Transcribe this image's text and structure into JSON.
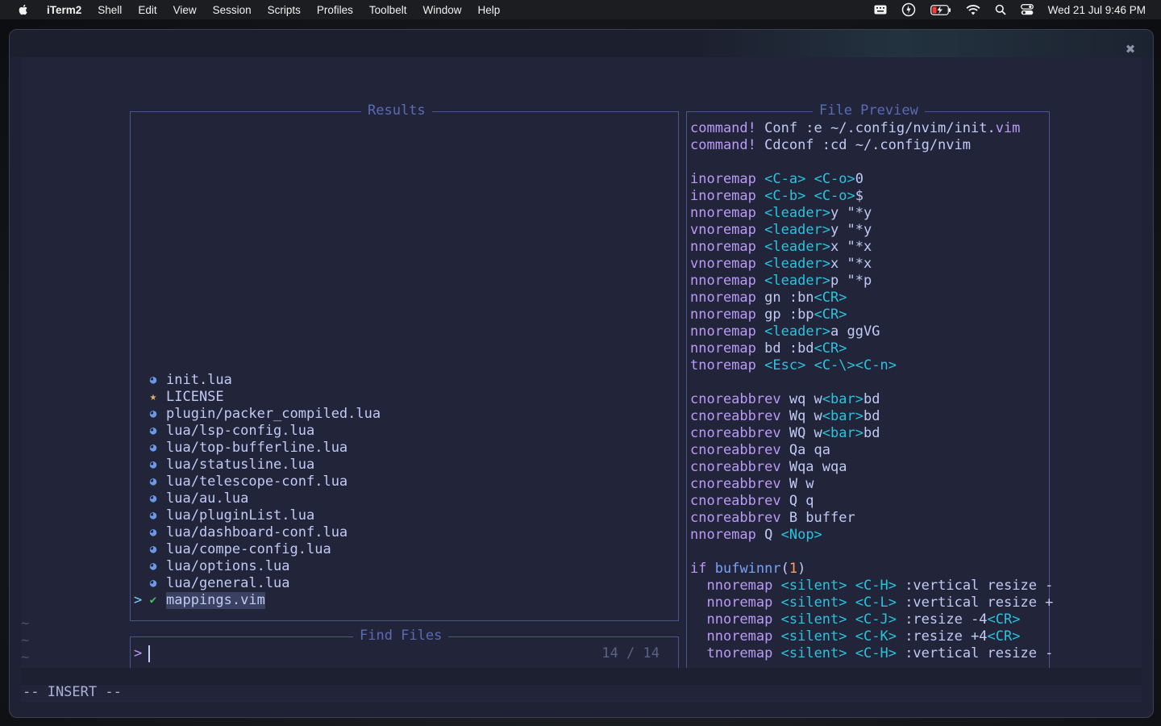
{
  "menubar": {
    "app_name": "iTerm2",
    "items": [
      "Shell",
      "Edit",
      "View",
      "Session",
      "Scripts",
      "Profiles",
      "Toolbelt",
      "Window",
      "Help"
    ],
    "clock": "Wed 21 Jul  9:46 PM",
    "status_icons": [
      "keyboard-icon",
      "vpn-icon",
      "battery-charging-icon",
      "wifi-icon",
      "spotlight-search-icon",
      "control-center-icon"
    ]
  },
  "telescope": {
    "results_title": "Results",
    "prompt_title": "Find Files",
    "preview_title": "File Preview",
    "prompt_symbol": ">",
    "selection_caret": ">",
    "counter": "14 / 14",
    "results": [
      {
        "name": "init.lua",
        "icon": "lua-icon"
      },
      {
        "name": "LICENSE",
        "icon": "license-icon"
      },
      {
        "name": "plugin/packer_compiled.lua",
        "icon": "lua-icon"
      },
      {
        "name": "lua/lsp-config.lua",
        "icon": "lua-icon"
      },
      {
        "name": "lua/top-bufferline.lua",
        "icon": "lua-icon"
      },
      {
        "name": "lua/statusline.lua",
        "icon": "lua-icon"
      },
      {
        "name": "lua/telescope-conf.lua",
        "icon": "lua-icon"
      },
      {
        "name": "lua/au.lua",
        "icon": "lua-icon"
      },
      {
        "name": "lua/pluginList.lua",
        "icon": "lua-icon"
      },
      {
        "name": "lua/dashboard-conf.lua",
        "icon": "lua-icon"
      },
      {
        "name": "lua/compe-config.lua",
        "icon": "lua-icon"
      },
      {
        "name": "lua/options.lua",
        "icon": "lua-icon"
      },
      {
        "name": "lua/general.lua",
        "icon": "lua-icon"
      },
      {
        "name": "mappings.vim",
        "icon": "vim-icon",
        "selected": true
      }
    ],
    "preview_lines": [
      [
        [
          "kw",
          "command!"
        ],
        [
          "tx",
          " Conf :e ~/.config/nvim/init."
        ],
        [
          "kw",
          "vim"
        ]
      ],
      [
        [
          "kw",
          "command!"
        ],
        [
          "tx",
          " Cdconf :cd ~/.config/nvim"
        ]
      ],
      [],
      [
        [
          "kw",
          "inoremap"
        ],
        [
          "tx",
          " "
        ],
        [
          "cy",
          "<C-a>"
        ],
        [
          "tx",
          " "
        ],
        [
          "cy",
          "<C-o>"
        ],
        [
          "tx",
          "0"
        ]
      ],
      [
        [
          "kw",
          "inoremap"
        ],
        [
          "tx",
          " "
        ],
        [
          "cy",
          "<C-b>"
        ],
        [
          "tx",
          " "
        ],
        [
          "cy",
          "<C-o>"
        ],
        [
          "tx",
          "$"
        ]
      ],
      [
        [
          "kw",
          "nnoremap"
        ],
        [
          "tx",
          " "
        ],
        [
          "cy",
          "<leader>"
        ],
        [
          "tx",
          "y \"*y"
        ]
      ],
      [
        [
          "kw",
          "vnoremap"
        ],
        [
          "tx",
          " "
        ],
        [
          "cy",
          "<leader>"
        ],
        [
          "tx",
          "y \"*y"
        ]
      ],
      [
        [
          "kw",
          "nnoremap"
        ],
        [
          "tx",
          " "
        ],
        [
          "cy",
          "<leader>"
        ],
        [
          "tx",
          "x \"*x"
        ]
      ],
      [
        [
          "kw",
          "vnoremap"
        ],
        [
          "tx",
          " "
        ],
        [
          "cy",
          "<leader>"
        ],
        [
          "tx",
          "x \"*x"
        ]
      ],
      [
        [
          "kw",
          "nnoremap"
        ],
        [
          "tx",
          " "
        ],
        [
          "cy",
          "<leader>"
        ],
        [
          "tx",
          "p \"*p"
        ]
      ],
      [
        [
          "kw",
          "nnoremap"
        ],
        [
          "tx",
          " gn :bn"
        ],
        [
          "cy",
          "<CR>"
        ]
      ],
      [
        [
          "kw",
          "nnoremap"
        ],
        [
          "tx",
          " gp :bp"
        ],
        [
          "cy",
          "<CR>"
        ]
      ],
      [
        [
          "kw",
          "nnoremap"
        ],
        [
          "tx",
          " "
        ],
        [
          "cy",
          "<leader>"
        ],
        [
          "tx",
          "a ggVG"
        ]
      ],
      [
        [
          "kw",
          "nnoremap"
        ],
        [
          "tx",
          " bd :bd"
        ],
        [
          "cy",
          "<CR>"
        ]
      ],
      [
        [
          "kw",
          "tnoremap"
        ],
        [
          "tx",
          " "
        ],
        [
          "cy",
          "<Esc>"
        ],
        [
          "tx",
          " "
        ],
        [
          "cy",
          "<C-\\><C-n>"
        ]
      ],
      [],
      [
        [
          "kw",
          "cnoreabbrev"
        ],
        [
          "tx",
          " wq w"
        ],
        [
          "cy",
          "<bar>"
        ],
        [
          "tx",
          "bd"
        ]
      ],
      [
        [
          "kw",
          "cnoreabbrev"
        ],
        [
          "tx",
          " Wq w"
        ],
        [
          "cy",
          "<bar>"
        ],
        [
          "tx",
          "bd"
        ]
      ],
      [
        [
          "kw",
          "cnoreabbrev"
        ],
        [
          "tx",
          " WQ w"
        ],
        [
          "cy",
          "<bar>"
        ],
        [
          "tx",
          "bd"
        ]
      ],
      [
        [
          "kw",
          "cnoreabbrev"
        ],
        [
          "tx",
          " Qa qa"
        ]
      ],
      [
        [
          "kw",
          "cnoreabbrev"
        ],
        [
          "tx",
          " Wqa wqa"
        ]
      ],
      [
        [
          "kw",
          "cnoreabbrev"
        ],
        [
          "tx",
          " W w"
        ]
      ],
      [
        [
          "kw",
          "cnoreabbrev"
        ],
        [
          "tx",
          " Q q"
        ]
      ],
      [
        [
          "kw",
          "cnoreabbrev"
        ],
        [
          "tx",
          " B buffer"
        ]
      ],
      [
        [
          "kw",
          "nnoremap"
        ],
        [
          "tx",
          " Q "
        ],
        [
          "cy",
          "<Nop>"
        ]
      ],
      [],
      [
        [
          "kw",
          "if"
        ],
        [
          "tx",
          " "
        ],
        [
          "fn",
          "bufwinnr"
        ],
        [
          "tx",
          "("
        ],
        [
          "nm",
          "1"
        ],
        [
          "tx",
          ")"
        ]
      ],
      [
        [
          "tx",
          "  "
        ],
        [
          "kw",
          "nnoremap"
        ],
        [
          "tx",
          " "
        ],
        [
          "cy",
          "<silent>"
        ],
        [
          "tx",
          " "
        ],
        [
          "cy",
          "<C-H>"
        ],
        [
          "tx",
          " :vertical resize -"
        ]
      ],
      [
        [
          "tx",
          "  "
        ],
        [
          "kw",
          "nnoremap"
        ],
        [
          "tx",
          " "
        ],
        [
          "cy",
          "<silent>"
        ],
        [
          "tx",
          " "
        ],
        [
          "cy",
          "<C-L>"
        ],
        [
          "tx",
          " :vertical resize +"
        ]
      ],
      [
        [
          "tx",
          "  "
        ],
        [
          "kw",
          "nnoremap"
        ],
        [
          "tx",
          " "
        ],
        [
          "cy",
          "<silent>"
        ],
        [
          "tx",
          " "
        ],
        [
          "cy",
          "<C-J>"
        ],
        [
          "tx",
          " :resize -4"
        ],
        [
          "cy",
          "<CR>"
        ]
      ],
      [
        [
          "tx",
          "  "
        ],
        [
          "kw",
          "nnoremap"
        ],
        [
          "tx",
          " "
        ],
        [
          "cy",
          "<silent>"
        ],
        [
          "tx",
          " "
        ],
        [
          "cy",
          "<C-K>"
        ],
        [
          "tx",
          " :resize +4"
        ],
        [
          "cy",
          "<CR>"
        ]
      ],
      [
        [
          "tx",
          "  "
        ],
        [
          "kw",
          "tnoremap"
        ],
        [
          "tx",
          " "
        ],
        [
          "cy",
          "<silent>"
        ],
        [
          "tx",
          " "
        ],
        [
          "cy",
          "<C-H>"
        ],
        [
          "tx",
          " :vertical resize -"
        ]
      ]
    ]
  },
  "editor": {
    "tilde": "~",
    "mode_line": "-- INSERT --"
  },
  "colors": {
    "background": "#222539",
    "border": "#4a5690",
    "keyword": "#bb9af7",
    "special": "#2ac3de",
    "text": "#c0caf5"
  }
}
